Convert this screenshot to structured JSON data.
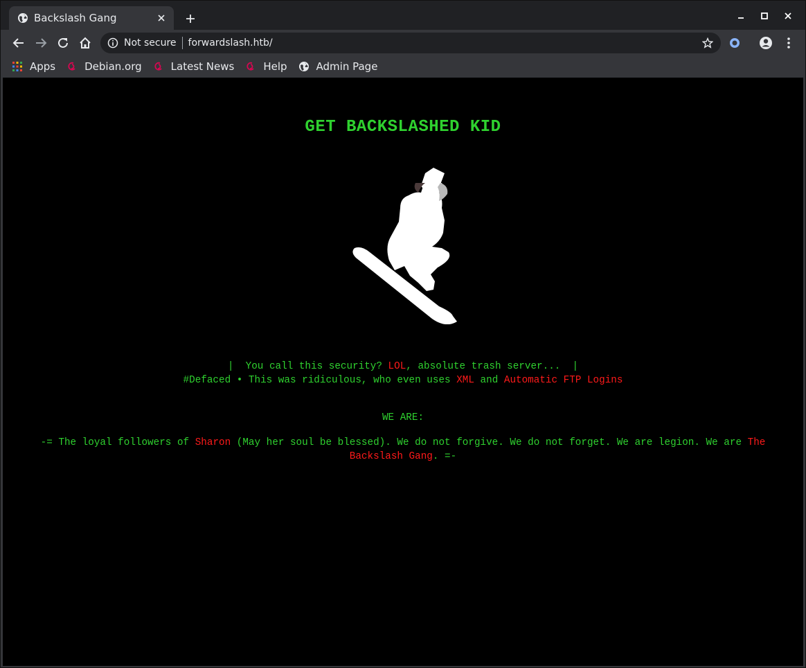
{
  "browser": {
    "tab_title": "Backslash Gang",
    "security_label": "Not secure",
    "url": "forwardslash.htb/",
    "colors": {
      "chrome_dark": "#202124",
      "chrome_mid": "#35363a",
      "text": "#e8eaed"
    }
  },
  "bookmarks": [
    {
      "label": "Apps",
      "icon": "apps-grid-icon"
    },
    {
      "label": "Debian.org",
      "icon": "debian-swirl-icon"
    },
    {
      "label": "Latest News",
      "icon": "debian-swirl-icon"
    },
    {
      "label": "Help",
      "icon": "debian-swirl-icon"
    },
    {
      "label": "Admin Page",
      "icon": "globe-icon"
    }
  ],
  "page": {
    "headline": "GET BACKSLASHED KID",
    "line1": {
      "pre": "|  You call this security? ",
      "highlight": "LOL",
      "post": ", absolute trash server...  |"
    },
    "line2": {
      "pre": "#Defaced • This was ridiculous, who even uses ",
      "highlight1": "XML",
      "mid": " and ",
      "highlight2": "Automatic FTP Logins"
    },
    "we_are": "WE ARE:",
    "manifesto": {
      "pre": "-= The loyal followers of ",
      "name": "Sharon",
      "mid": " (May her soul be blessed). We do not forgive. We do not forget. We are legion. We are ",
      "gang": "The Backslash Gang",
      "post": ". =-"
    },
    "colors": {
      "background": "#000000",
      "green": "#2fd12f",
      "red": "#ff1a1a"
    }
  }
}
